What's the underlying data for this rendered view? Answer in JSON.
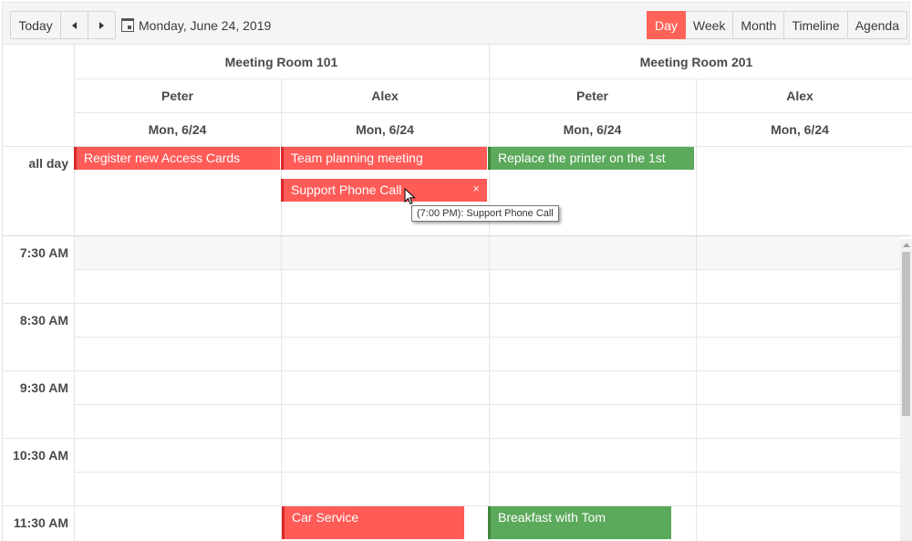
{
  "toolbar": {
    "today": "Today",
    "current_date": "Monday, June 24, 2019",
    "views": [
      "Day",
      "Week",
      "Month",
      "Timeline",
      "Agenda"
    ],
    "active_view": "Day"
  },
  "rooms": [
    "Meeting Room 101",
    "Meeting Room 201"
  ],
  "people": [
    "Peter",
    "Alex",
    "Peter",
    "Alex"
  ],
  "dates": [
    "Mon, 6/24",
    "Mon, 6/24",
    "Mon, 6/24",
    "Mon, 6/24"
  ],
  "all_day_label": "all day",
  "times": [
    "7:30 AM",
    "8:30 AM",
    "9:30 AM",
    "10:30 AM",
    "11:30 AM"
  ],
  "all_day_events": [
    {
      "title": "Register new Access Cards",
      "color": "#ff5b57"
    },
    {
      "title": "Team planning meeting",
      "color": "#ff5b57"
    },
    {
      "title": "Support Phone Call",
      "color": "#ff5b57",
      "close": "×"
    },
    {
      "title": "Replace the printer on the 1st",
      "color": "#5ba95b"
    }
  ],
  "timed_events": [
    {
      "title": "Car Service",
      "color": "#ff5b57"
    },
    {
      "title": "Breakfast with Tom",
      "color": "#5ba95b"
    }
  ],
  "tooltip": "(7:00 PM): Support Phone Call",
  "colors": {
    "accent": "#ff6358",
    "red_event": "#ff5b57",
    "green_event": "#5ba95b"
  }
}
